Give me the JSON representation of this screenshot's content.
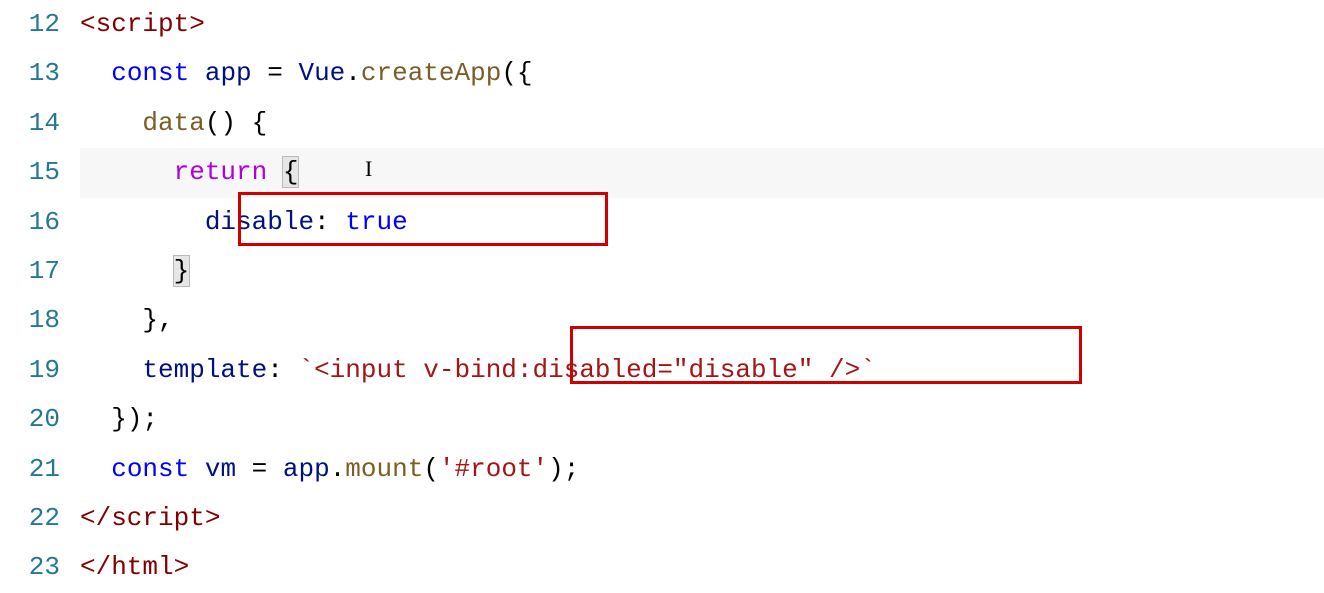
{
  "editor": {
    "lineNumbers": [
      "12",
      "13",
      "14",
      "15",
      "16",
      "17",
      "18",
      "19",
      "20",
      "21",
      "22",
      "23"
    ],
    "cursorGlyph": "I",
    "lines": {
      "l12": {
        "tagOpen": "<script>",
        "trail": ""
      },
      "l13": {
        "indent": "  ",
        "kw": "const",
        "sp": " ",
        "v1": "app",
        "eq": " = ",
        "ns": "Vue",
        "dot": ".",
        "fn": "createApp",
        "paren": "({"
      },
      "l14": {
        "indent": "    ",
        "fn": "data",
        "paren": "() {"
      },
      "l15": {
        "indent": "      ",
        "kw": "return",
        "sp": " ",
        "brace": "{"
      },
      "l16": {
        "indent": "        ",
        "key": "disable",
        "colon": ": ",
        "val": "true"
      },
      "l17": {
        "indent": "      ",
        "brace": "}"
      },
      "l18": {
        "indent": "    ",
        "txt": "},"
      },
      "l19": {
        "indent": "    ",
        "key": "template",
        "colon": ": ",
        "backtick1": "`",
        "str": "<input v-bind:disabled=\"disable\" />",
        "backtick2": "`"
      },
      "l20": {
        "indent": "  ",
        "txt": "});"
      },
      "l21": {
        "indent": "  ",
        "kw": "const",
        "sp": " ",
        "v1": "vm",
        "eq": " = ",
        "v2": "app",
        "dot": ".",
        "fn": "mount",
        "paren": "(",
        "str": "'#root'",
        "paren2": ");"
      },
      "l22": {
        "tagClose": "</script>"
      },
      "l23": {
        "tagClose": "</html>"
      }
    }
  },
  "highlights": {
    "box1": "disable: true",
    "box2": "v-bind:disabled=\"disable\" />"
  }
}
